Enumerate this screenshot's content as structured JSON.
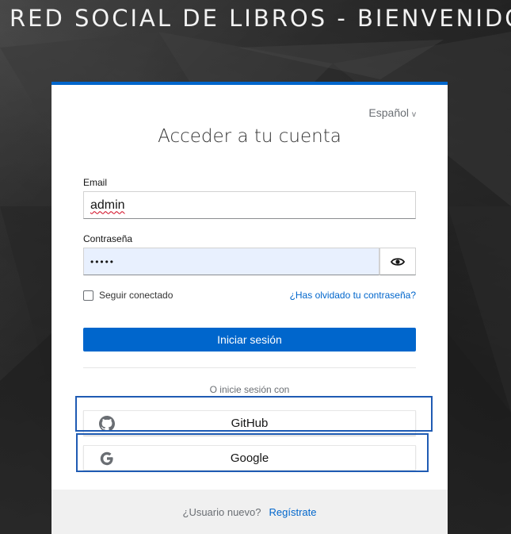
{
  "header": {
    "title": "RED SOCIAL DE LIBROS - BIENVENIDO"
  },
  "language": {
    "selected": "Español"
  },
  "login": {
    "title": "Acceder a tu cuenta",
    "email_label": "Email",
    "email_value": "admin",
    "password_label": "Contraseña",
    "password_value": "•••••",
    "remember_label": "Seguir conectado",
    "remember_checked": false,
    "forgot_link": "¿Has olvidado tu contraseña?",
    "submit_label": "Iniciar sesión"
  },
  "social": {
    "intro": "O inicie sesión con",
    "providers": [
      {
        "label": "GitHub",
        "icon": "github-icon"
      },
      {
        "label": "Google",
        "icon": "google-icon"
      }
    ]
  },
  "footer": {
    "prompt": "¿Usuario nuevo?",
    "register_link": "Regístrate"
  },
  "colors": {
    "primary": "#0066cc",
    "password_fill": "#e8f0fe",
    "highlight_outline": "#1f5bb3"
  }
}
